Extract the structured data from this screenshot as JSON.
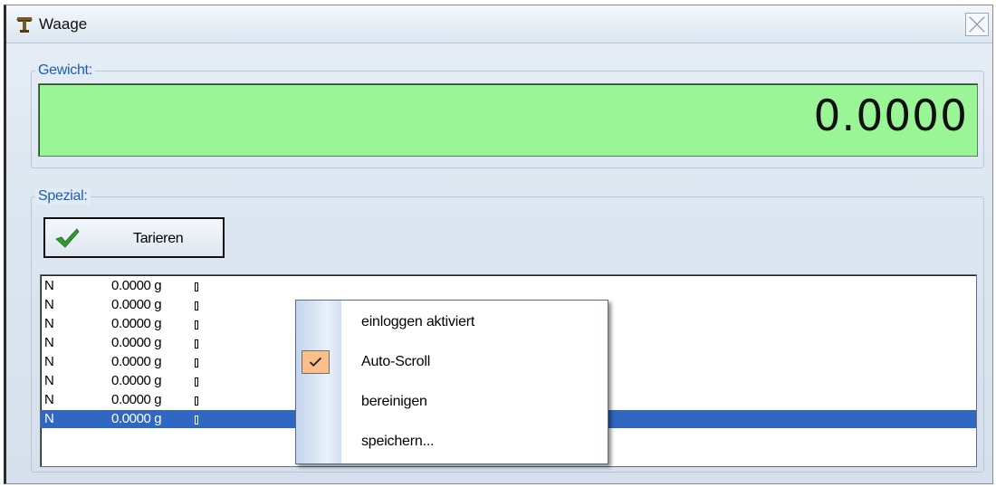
{
  "window": {
    "title": "Waage",
    "icon": "scale-icon"
  },
  "gewicht": {
    "label": "Gewicht:",
    "value": "0.0000",
    "display_color": "#99f596"
  },
  "spezial": {
    "label": "Spezial:",
    "tare_button": {
      "label": "Tarieren",
      "icon": "checkmark-icon"
    }
  },
  "log": {
    "rows": [
      {
        "flag": "N",
        "weight": "0.0000 g",
        "selected": false
      },
      {
        "flag": "N",
        "weight": "0.0000 g",
        "selected": false
      },
      {
        "flag": "N",
        "weight": "0.0000 g",
        "selected": false
      },
      {
        "flag": "N",
        "weight": "0.0000 g",
        "selected": false
      },
      {
        "flag": "N",
        "weight": "0.0000 g",
        "selected": false
      },
      {
        "flag": "N",
        "weight": "0.0000 g",
        "selected": false
      },
      {
        "flag": "N",
        "weight": "0.0000 g",
        "selected": false
      },
      {
        "flag": "N",
        "weight": "0.0000 g",
        "selected": true
      }
    ],
    "selection_color": "#2f67c2"
  },
  "context_menu": {
    "items": [
      {
        "label": "einloggen aktiviert",
        "checked": false
      },
      {
        "label": "Auto-Scroll",
        "checked": true
      },
      {
        "label": "bereinigen",
        "checked": false
      },
      {
        "label": "speichern...",
        "checked": false
      }
    ],
    "check_color": "#fbbf8a"
  }
}
